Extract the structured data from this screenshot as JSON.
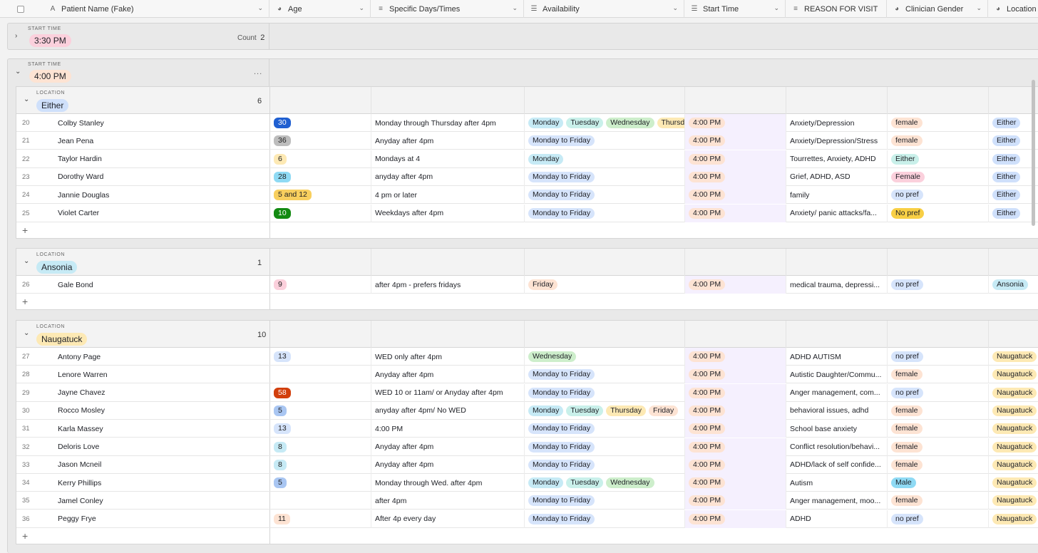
{
  "columns": [
    {
      "label": "Patient Name (Fake)",
      "icon": "text-field-icon"
    },
    {
      "label": "Age",
      "icon": "single-select-icon"
    },
    {
      "label": "Specific Days/Times",
      "icon": "long-text-icon"
    },
    {
      "label": "Availability",
      "icon": "multi-select-icon"
    },
    {
      "label": "Start Time",
      "icon": "multi-select-icon"
    },
    {
      "label": "REASON FOR VISIT",
      "icon": "long-text-icon"
    },
    {
      "label": "Clinician Gender",
      "icon": "single-select-icon"
    },
    {
      "label": "Location",
      "icon": "single-select-icon"
    }
  ],
  "groups": {
    "g1": {
      "field": "START TIME",
      "value": "3:30 PM",
      "count_label": "Count",
      "count": "2"
    },
    "g2": {
      "field": "START TIME",
      "value": "4:00 PM",
      "more": "..."
    }
  },
  "subgroups": [
    {
      "field": "LOCATION",
      "value": "Either",
      "count": "6",
      "color": "#cfe0fb",
      "rows": [
        {
          "n": "20",
          "name": "Colby Stanley",
          "age": "30",
          "ageColor": "#1f5fd1",
          "ageText": "#ffffff",
          "days": "Monday through Thursday after 4pm",
          "avail": [
            "Monday",
            "Tuesday",
            "Wednesday",
            "Thursday"
          ],
          "time": "4:00 PM",
          "reason": "Anxiety/Depression",
          "gender": "female",
          "genderColor": "#fde3d3",
          "loc": "Either",
          "locColor": "#cfe0fb"
        },
        {
          "n": "21",
          "name": "Jean Pena",
          "age": "36",
          "ageColor": "#bdbdbd",
          "ageText": "#222",
          "days": "Anyday after 4pm",
          "avail": [
            "Monday to Friday"
          ],
          "time": "4:00 PM",
          "reason": "Anxiety/Depression/Stress",
          "gender": "female",
          "genderColor": "#fde3d3",
          "loc": "Either",
          "locColor": "#cfe0fb"
        },
        {
          "n": "22",
          "name": "Taylor Hardin",
          "age": "6",
          "ageColor": "#fde9b4",
          "ageText": "#222",
          "days": "Mondays at 4",
          "avail": [
            "Monday"
          ],
          "time": "4:00 PM",
          "reason": "Tourrettes, Anxiety, ADHD",
          "gender": "Either",
          "genderColor": "#c9f0ea",
          "loc": "Either",
          "locColor": "#cfe0fb"
        },
        {
          "n": "23",
          "name": "Dorothy Ward",
          "age": "28",
          "ageColor": "#8fdaf4",
          "ageText": "#222",
          "days": "anyday after 4pm",
          "avail": [
            "Monday to Friday"
          ],
          "time": "4:00 PM",
          "reason": "Grief, ADHD, ASD",
          "gender": "Female",
          "genderColor": "#fbd0dc",
          "loc": "Either",
          "locColor": "#cfe0fb"
        },
        {
          "n": "24",
          "name": "Jannie Douglas",
          "age": "5 and 12",
          "ageColor": "#f8cf5e",
          "ageText": "#222",
          "days": "4 pm or later",
          "avail": [
            "Monday to Friday"
          ],
          "time": "4:00 PM",
          "reason": "family",
          "gender": "no pref",
          "genderColor": "#d6e4fb",
          "loc": "Either",
          "locColor": "#cfe0fb"
        },
        {
          "n": "25",
          "name": "Violet Carter",
          "age": "10",
          "ageColor": "#138a12",
          "ageText": "#ffffff",
          "days": "Weekdays after 4pm",
          "avail": [
            "Monday to Friday"
          ],
          "time": "4:00 PM",
          "reason": "Anxiety/ panic attacks/fa...",
          "gender": "No pref",
          "genderColor": "#f8cf45",
          "loc": "Either",
          "locColor": "#cfe0fb"
        }
      ]
    },
    {
      "field": "LOCATION",
      "value": "Ansonia",
      "count": "1",
      "color": "#c6eaf5",
      "rows": [
        {
          "n": "26",
          "name": "Gale Bond",
          "age": "9",
          "ageColor": "#fbd0dc",
          "ageText": "#222",
          "days": "after 4pm - prefers fridays",
          "avail": [
            "Friday"
          ],
          "time": "4:00 PM",
          "reason": "medical trauma, depressi...",
          "gender": "no pref",
          "genderColor": "#d6e4fb",
          "loc": "Ansonia",
          "locColor": "#c6eaf5"
        }
      ]
    },
    {
      "field": "LOCATION",
      "value": "Naugatuck",
      "count": "10",
      "color": "#fde9b4",
      "rows": [
        {
          "n": "27",
          "name": "Antony Page",
          "age": "13",
          "ageColor": "#d6e4fb",
          "ageText": "#222",
          "days": "WED only after 4pm",
          "avail": [
            "Wednesday"
          ],
          "time": "4:00 PM",
          "reason": "ADHD AUTISM",
          "gender": "no pref",
          "genderColor": "#d6e4fb",
          "loc": "Naugatuck",
          "locColor": "#fde9b4"
        },
        {
          "n": "28",
          "name": "Lenore Warren",
          "age": "",
          "ageColor": "",
          "ageText": "",
          "days": "Anyday after 4pm",
          "avail": [
            "Monday to Friday"
          ],
          "time": "4:00 PM",
          "reason": "Autistic Daughter/Commu...",
          "gender": "female",
          "genderColor": "#fde3d3",
          "loc": "Naugatuck",
          "locColor": "#fde9b4"
        },
        {
          "n": "29",
          "name": "Jayne Chavez",
          "age": "58",
          "ageColor": "#d23f0c",
          "ageText": "#ffffff",
          "days": "WED 10 or 11am/ or Anyday after 4pm",
          "avail": [
            "Monday to Friday"
          ],
          "time": "4:00 PM",
          "reason": "Anger management, com...",
          "gender": "no pref",
          "genderColor": "#d6e4fb",
          "loc": "Naugatuck",
          "locColor": "#fde9b4"
        },
        {
          "n": "30",
          "name": "Rocco Mosley",
          "age": "5",
          "ageColor": "#a9c6f2",
          "ageText": "#222",
          "days": "anyday after 4pm/ No WED",
          "avail": [
            "Monday",
            "Tuesday",
            "Thursday",
            "Friday"
          ],
          "time": "4:00 PM",
          "reason": "behavioral issues, adhd",
          "gender": "female",
          "genderColor": "#fde3d3",
          "loc": "Naugatuck",
          "locColor": "#fde9b4"
        },
        {
          "n": "31",
          "name": "Karla Massey",
          "age": "13",
          "ageColor": "#d6e4fb",
          "ageText": "#222",
          "days": "4:00 PM",
          "avail": [
            "Monday to Friday"
          ],
          "time": "4:00 PM",
          "reason": "School base anxiety",
          "gender": "female",
          "genderColor": "#fde3d3",
          "loc": "Naugatuck",
          "locColor": "#fde9b4"
        },
        {
          "n": "32",
          "name": "Deloris Love",
          "age": "8",
          "ageColor": "#c6eaf5",
          "ageText": "#222",
          "days": "Anyday after 4pm",
          "avail": [
            "Monday to Friday"
          ],
          "time": "4:00 PM",
          "reason": "Conflict resolution/behavi...",
          "gender": "female",
          "genderColor": "#fde3d3",
          "loc": "Naugatuck",
          "locColor": "#fde9b4"
        },
        {
          "n": "33",
          "name": "Jason Mcneil",
          "age": "8",
          "ageColor": "#c6eaf5",
          "ageText": "#222",
          "days": "Anyday after 4pm",
          "avail": [
            "Monday to Friday"
          ],
          "time": "4:00 PM",
          "reason": "ADHD/lack of self confide...",
          "gender": "female",
          "genderColor": "#fde3d3",
          "loc": "Naugatuck",
          "locColor": "#fde9b4"
        },
        {
          "n": "34",
          "name": "Kerry Phillips",
          "age": "5",
          "ageColor": "#a9c6f2",
          "ageText": "#222",
          "days": "Monday through Wed. after 4pm",
          "avail": [
            "Monday",
            "Tuesday",
            "Wednesday"
          ],
          "time": "4:00 PM",
          "reason": "Autism",
          "gender": "Male",
          "genderColor": "#8fdaf4",
          "loc": "Naugatuck",
          "locColor": "#fde9b4"
        },
        {
          "n": "35",
          "name": "Jamel Conley",
          "age": "",
          "ageColor": "",
          "ageText": "",
          "days": "after 4pm",
          "avail": [
            "Monday to Friday"
          ],
          "time": "4:00 PM",
          "reason": "Anger management, moo...",
          "gender": "female",
          "genderColor": "#fde3d3",
          "loc": "Naugatuck",
          "locColor": "#fde9b4"
        },
        {
          "n": "36",
          "name": "Peggy Frye",
          "age": "11",
          "ageColor": "#fde3d3",
          "ageText": "#222",
          "days": "After 4p every day",
          "avail": [
            "Monday to Friday"
          ],
          "time": "4:00 PM",
          "reason": "ADHD",
          "gender": "no pref",
          "genderColor": "#d6e4fb",
          "loc": "Naugatuck",
          "locColor": "#fde9b4"
        }
      ]
    }
  ],
  "availColors": {
    "Monday": "#c6eaf5",
    "Tuesday": "#c9f0ea",
    "Wednesday": "#cdeecb",
    "Thursday": "#fde9b4",
    "Friday": "#fde3d3",
    "Monday to Friday": "#d6e4fb"
  },
  "colors": {
    "time_pill": "#fde3d3",
    "g1_time_pill": "#fbd0dc"
  },
  "add_symbol": "+"
}
